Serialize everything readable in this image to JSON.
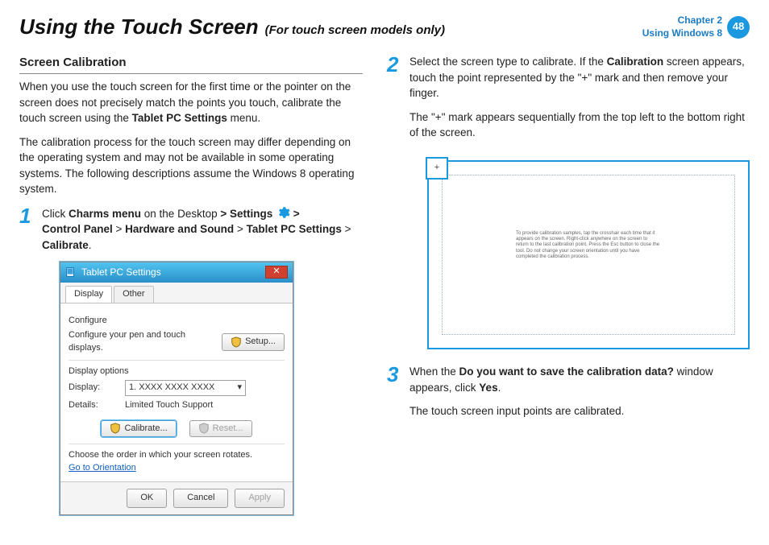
{
  "header": {
    "title": "Using the Touch Screen",
    "subtitle": "(For touch screen models only)",
    "chapter_line1": "Chapter 2",
    "chapter_line2": "Using Windows 8",
    "page_number": "48"
  },
  "left": {
    "section_title": "Screen Calibration",
    "intro_p1_a": "When you use the touch screen for the first time or the pointer on the screen does not precisely match the points you touch, calibrate the touch screen using the ",
    "intro_p1_bold": "Tablet PC Settings",
    "intro_p1_b": " menu.",
    "intro_p2": "The calibration process for the touch screen may differ depending on the operating system and may not be available in some operating systems. The following descriptions assume the Windows 8 operating system.",
    "step1_num": "1",
    "step1_a": "Click ",
    "step1_b": "Charms menu",
    "step1_c": " on the Desktop ",
    "step1_d": "> Settings",
    "step1_e": " > ",
    "step1_line2a": "Control Panel",
    "step1_line2b": " > ",
    "step1_line2c": "Hardware and Sound",
    "step1_line2d": " > ",
    "step1_line2e": "Tablet PC Settings",
    "step1_line2f": " > ",
    "step1_line2g": "Calibrate",
    "step1_line2h": "."
  },
  "dialog": {
    "title": "Tablet PC Settings",
    "tab_display": "Display",
    "tab_other": "Other",
    "configure_label": "Configure",
    "configure_text": "Configure your pen and touch displays.",
    "setup_btn": "Setup...",
    "display_options_label": "Display options",
    "display_label": "Display:",
    "display_value": "1. XXXX XXXX XXXX",
    "details_label": "Details:",
    "details_value": "Limited Touch Support",
    "calibrate_btn": "Calibrate...",
    "reset_btn": "Reset...",
    "rotate_text": "Choose the order in which your screen rotates.",
    "orientation_link": "Go to Orientation",
    "ok": "OK",
    "cancel": "Cancel",
    "apply": "Apply"
  },
  "right": {
    "step2_num": "2",
    "step2_a": "Select the screen type to calibrate. If the ",
    "step2_b": "Calibration",
    "step2_c": " screen appears, touch the point represented by the \"+\" mark and then remove your finger.",
    "step2_p2": "The \"+\" mark appears sequentially from the top left to the bottom right of the screen.",
    "calib_plus": "+",
    "calib_screen_text": "To provide calibration samples, tap the crosshair each time that it appears on the screen.\n\nRight-click anywhere on the screen to return to the last calibration point. Press the Esc button to close the tool. Do not change your screen orientation until you have completed the calibration process.",
    "step3_num": "3",
    "step3_a": "When the ",
    "step3_b": "Do you want to save the calibration data?",
    "step3_c": " window appears, click ",
    "step3_d": "Yes",
    "step3_e": ".",
    "step3_p2": "The touch screen input points are calibrated."
  }
}
